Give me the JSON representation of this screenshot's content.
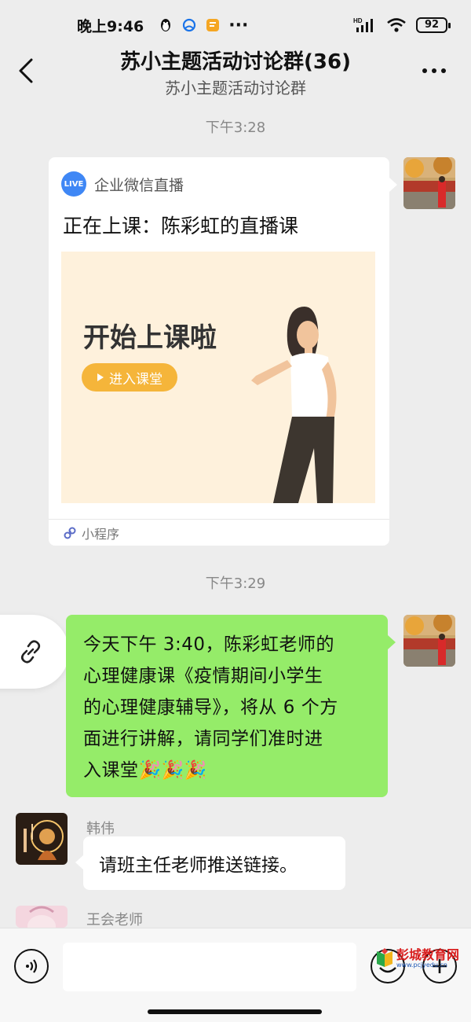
{
  "status_bar": {
    "time": "晚上9:46",
    "dots": "···",
    "network": "HD",
    "battery": "92"
  },
  "nav": {
    "title": "苏小主题活动讨论群(36)",
    "subtitle": "苏小主题活动讨论群"
  },
  "messages": {
    "time_1": "下午3:28",
    "live_card": {
      "badge": "LIVE",
      "source": "企业微信直播",
      "title": "正在上课：陈彩虹的直播课",
      "banner_text": "开始上课啦",
      "enter_label": "进入课堂",
      "footer": "小程序"
    },
    "time_2": "下午3:29",
    "announcement": {
      "lines": [
        "今天下午 3:40，陈彩虹老师的",
        "心理健康课《疫情期间小学生",
        "的心理健康辅导》，将从 6 个方",
        "面进行讲解，请同学们准时进",
        "入课堂🎉🎉🎉"
      ]
    },
    "msg_hanwei": {
      "sender": "韩伟",
      "text": "请班主任老师推送链接。"
    },
    "msg_wanghui": {
      "sender": "王会老师"
    }
  },
  "input_bar": {
    "placeholder": ""
  },
  "watermark": {
    "text": "彭城教育网",
    "url": "www.pcjyedu.cn"
  },
  "colors": {
    "background": "#ededed",
    "self_bubble": "#95ec69",
    "live_badge": "#3f87f5",
    "banner_bg": "#fef1dc",
    "enter_button": "#f5b53a"
  }
}
